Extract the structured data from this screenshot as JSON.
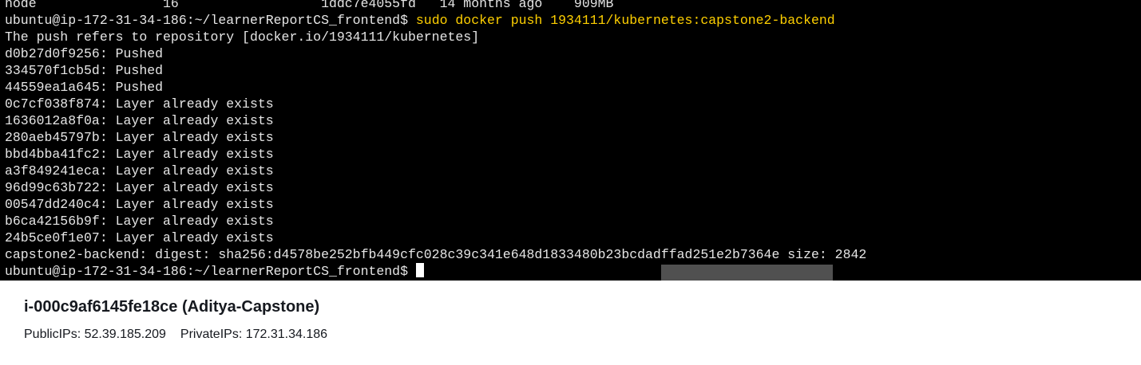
{
  "terminal": {
    "header_line": "node                16                  1ddc7e4055fd   14 months ago    909MB",
    "prompt_1": "ubuntu@ip-172-31-34-186:~/learnerReportCS_frontend$",
    "command_1": "sudo docker push 1934111/kubernetes:capstone2-backend",
    "output_lines": [
      "The push refers to repository [docker.io/1934111/kubernetes]",
      "d0b27d0f9256: Pushed",
      "334570f1cb5d: Pushed",
      "44559ea1a645: Pushed",
      "0c7cf038f874: Layer already exists",
      "1636012a8f0a: Layer already exists",
      "280aeb45797b: Layer already exists",
      "bbd4bba41fc2: Layer already exists",
      "a3f849241eca: Layer already exists",
      "96d99c63b722: Layer already exists",
      "00547dd240c4: Layer already exists",
      "b6ca42156b9f: Layer already exists",
      "24b5ce0f1e07: Layer already exists",
      "capstone2-backend: digest: sha256:d4578be252bfb449cfc028c39c341e648d1833480b23bcdadffad251e2b7364e size: 2842"
    ],
    "prompt_2": "ubuntu@ip-172-31-34-186:~/learnerReportCS_frontend$"
  },
  "instance": {
    "title": "i-000c9af6145fe18ce (Aditya-Capstone)",
    "public_ips": "PublicIPs: 52.39.185.209",
    "private_ips": "PrivateIPs: 172.31.34.186"
  }
}
